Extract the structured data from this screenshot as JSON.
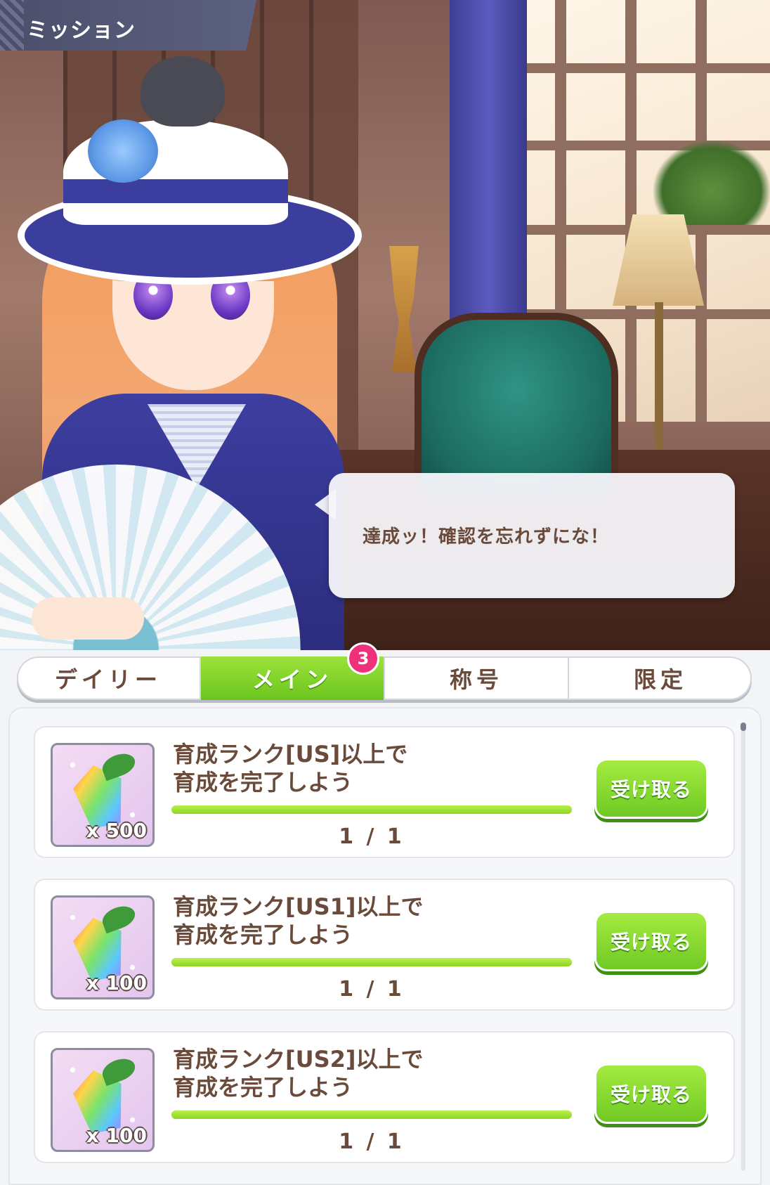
{
  "header": {
    "title": "ミッション"
  },
  "dialogue": {
    "text": "達成ッ！確認を忘れずにな！"
  },
  "tabs": [
    {
      "label": "デイリー",
      "active": false
    },
    {
      "label": "メイン",
      "active": true,
      "badge": "3"
    },
    {
      "label": "称号",
      "active": false
    },
    {
      "label": "限定",
      "active": false
    }
  ],
  "missions": [
    {
      "title": "育成ランク[US]以上で\n育成を完了しよう",
      "reward_qty": "x 500",
      "reward_icon": "rainbow-carrot-gem-icon",
      "progress_text": "1 / 1",
      "progress": 1.0,
      "button_label": "受け取る"
    },
    {
      "title": "育成ランク[US1]以上で\n育成を完了しよう",
      "reward_qty": "x 100",
      "reward_icon": "rainbow-carrot-gem-icon",
      "progress_text": "1 / 1",
      "progress": 1.0,
      "button_label": "受け取る"
    },
    {
      "title": "育成ランク[US2]以上で\n育成を完了しよう",
      "reward_qty": "x 100",
      "reward_icon": "rainbow-carrot-gem-icon",
      "progress_text": "1 / 1",
      "progress": 1.0,
      "button_label": "受け取る"
    }
  ],
  "colors": {
    "accent_green": "#7ccf26",
    "badge_pink": "#f0307a",
    "text_brown": "#6a4a3a"
  }
}
